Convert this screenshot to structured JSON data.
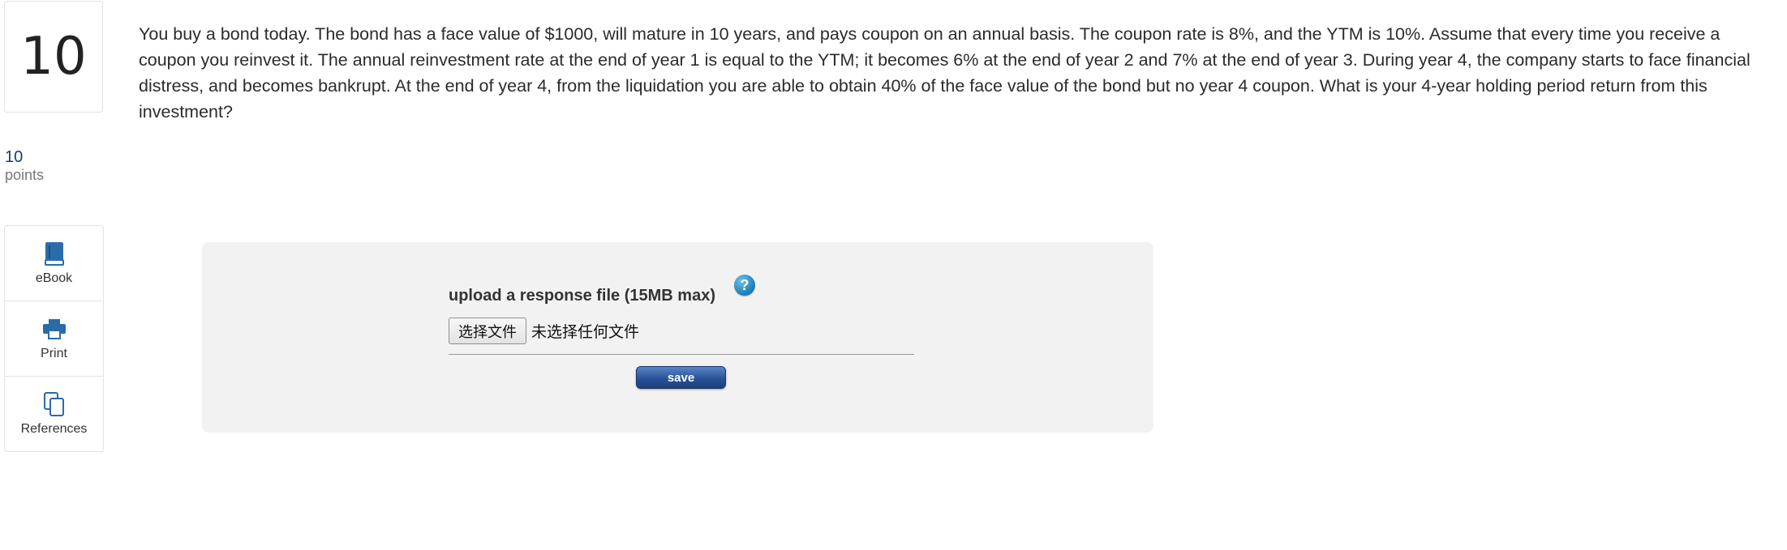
{
  "question": {
    "number": "10",
    "points_value": "10",
    "points_label": "points",
    "text": "You buy a bond today.  The bond has a face value of $1000, will mature in 10 years, and pays coupon on an annual basis.  The coupon rate is 8%, and the YTM is 10%. Assume that every time you receive a coupon you reinvest it. The annual reinvestment rate at the end of year 1 is equal to the YTM; it becomes 6% at the end of year 2 and 7% at the end of year 3.  During year 4, the company starts to face financial distress, and becomes bankrupt. At the end of year 4, from the liquidation you are able to obtain 40% of the face value of the bond but no year 4 coupon. What is your 4-year holding period return from this investment?"
  },
  "tools": [
    {
      "label": "eBook",
      "icon": "book-icon"
    },
    {
      "label": "Print",
      "icon": "printer-icon"
    },
    {
      "label": "References",
      "icon": "copy-icon"
    }
  ],
  "upload": {
    "label": "upload a response file (15MB max)",
    "help_glyph": "?",
    "choose_file_label": "选择文件",
    "no_file_text": "未选择任何文件",
    "save_label": "save"
  },
  "colors": {
    "accent_blue": "#2a6ca8",
    "save_button": "#2a5298",
    "panel_bg": "#f2f2f2",
    "points_value": "#1f3b63"
  }
}
